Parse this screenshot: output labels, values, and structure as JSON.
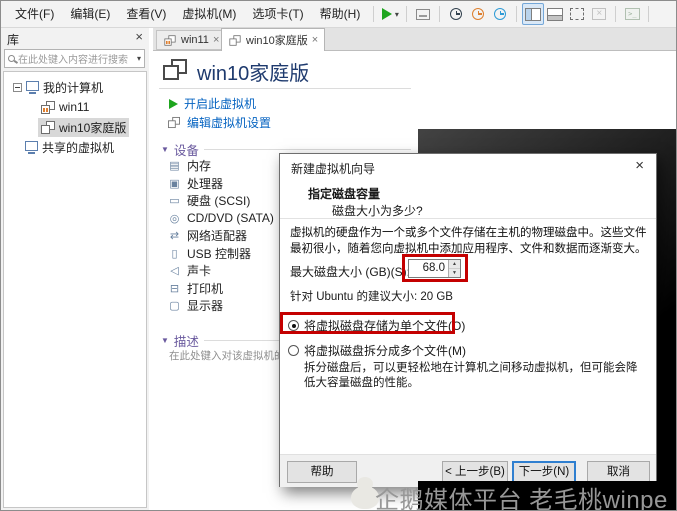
{
  "colors": {
    "highlight_red": "#c40000",
    "link_blue": "#0563c1",
    "title_navy": "#1e3a6e",
    "section_purple": "#6a5a9e",
    "play_green": "#1ea51e",
    "suspend_orange": "#e08030",
    "default_button_blue": "#2f7fd0"
  },
  "menu_bar": {
    "items": [
      {
        "label": "文件(F)"
      },
      {
        "label": "编辑(E)"
      },
      {
        "label": "查看(V)"
      },
      {
        "label": "虚拟机(M)"
      },
      {
        "label": "选项卡(T)"
      },
      {
        "label": "帮助(H)"
      }
    ]
  },
  "toolbar": {
    "icons": [
      "power-on-play-icon",
      "play-dropdown-arrow-icon",
      "send-ctrl-alt-del-icon",
      "take-snapshot-icon",
      "revert-snapshot-icon",
      "manage-snapshots-icon",
      "library-panel-toggle-icon",
      "thumbnail-bar-toggle-icon",
      "fullscreen-icon",
      "unity-mode-icon",
      "console-view-icon"
    ],
    "unity_glyph": "×",
    "console_glyph": ">_"
  },
  "sidebar": {
    "title": "库",
    "close_glyph": "×",
    "search": {
      "placeholder": "在此处键入内容进行搜索",
      "dropdown_glyph": "▾"
    },
    "tree": [
      {
        "label": "我的计算机"
      },
      {
        "label": "win11",
        "state": "suspended"
      },
      {
        "label": "win10家庭版",
        "selected": true
      },
      {
        "label": "共享的虚拟机"
      }
    ]
  },
  "tabs": [
    {
      "label": "win11",
      "close_glyph": "×"
    },
    {
      "label": "win10家庭版",
      "close_glyph": "×",
      "active": true
    }
  ],
  "vm_page": {
    "title": "win10家庭版",
    "power_link": "开启此虚拟机",
    "edit_link": "编辑虚拟机设置",
    "devices_header": "设备",
    "section_arrow": "▼",
    "devices": [
      {
        "label": "内存",
        "glyph": "▤"
      },
      {
        "label": "处理器",
        "glyph": "▣"
      },
      {
        "label": "硬盘 (SCSI)",
        "glyph": "▭"
      },
      {
        "label": "CD/DVD (SATA)",
        "glyph": "◎"
      },
      {
        "label": "网络适配器",
        "glyph": "⇄"
      },
      {
        "label": "USB 控制器",
        "glyph": "▯"
      },
      {
        "label": "声卡",
        "glyph": "◁"
      },
      {
        "label": "打印机",
        "glyph": "⊟"
      },
      {
        "label": "显示器",
        "glyph": "▢"
      }
    ],
    "description_header": "描述",
    "description_placeholder": "在此处键入对该虚拟机的描"
  },
  "dialog": {
    "title": "新建虚拟机向导",
    "close_glyph": "×",
    "heading": "指定磁盘容量",
    "subheading": "磁盘大小为多少?",
    "body": "虚拟机的硬盘作为一个或多个文件存储在主机的物理磁盘中。这些文件最初很小，随着您向虚拟机中添加应用程序、文件和数据而逐渐变大。",
    "max_disk_label": "最大磁盘大小 (GB)(S):",
    "max_disk_value": "68.0",
    "spin_up_glyph": "▲",
    "spin_down_glyph": "▼",
    "recommendation": "针对 Ubuntu 的建议大小: 20 GB",
    "radio_single_file": "将虚拟磁盘存储为单个文件(O)",
    "radio_split_files": "将虚拟磁盘拆分成多个文件(M)",
    "split_note": "拆分磁盘后，可以更轻松地在计算机之间移动虚拟机，但可能会降低大容量磁盘的性能。",
    "buttons": {
      "help": "帮助",
      "back": "< 上一步(B)",
      "next": "下一步(N) >",
      "cancel": "取消"
    }
  },
  "watermark": {
    "text": "企鹅媒体平台 老毛桃winpe"
  }
}
